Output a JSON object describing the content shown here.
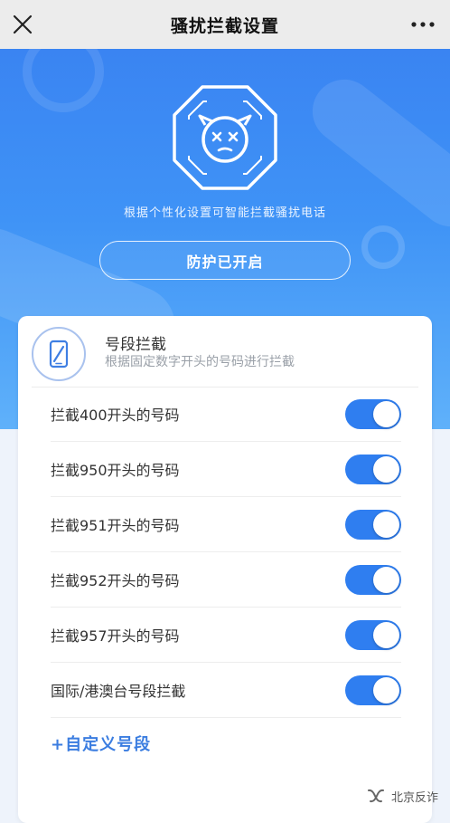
{
  "topbar": {
    "title": "骚扰拦截设置",
    "close_icon": "close-icon",
    "more_icon": "more-icon"
  },
  "hero": {
    "subtitle": "根据个性化设置可智能拦截骚扰电话",
    "status_button": "防护已开启",
    "shield_icon": "shield-face-icon"
  },
  "card": {
    "icon": "phone-block-icon",
    "title": "号段拦截",
    "subtitle": "根据固定数字开头的号码进行拦截",
    "rows": [
      {
        "label": "拦截400开头的号码",
        "enabled": true
      },
      {
        "label": "拦截950开头的号码",
        "enabled": true
      },
      {
        "label": "拦截951开头的号码",
        "enabled": true
      },
      {
        "label": "拦截952开头的号码",
        "enabled": true
      },
      {
        "label": "拦截957开头的号码",
        "enabled": true
      },
      {
        "label": "国际/港澳台号段拦截",
        "enabled": true
      }
    ],
    "custom_link": "+自定义号段"
  },
  "watermark": {
    "text": "北京反诈",
    "icon": "wechat-channel-icon"
  },
  "colors": {
    "accent": "#2f7ef0",
    "hero_top": "#3a84f2",
    "hero_bottom": "#5fb1fa",
    "link": "#3b7de0"
  }
}
